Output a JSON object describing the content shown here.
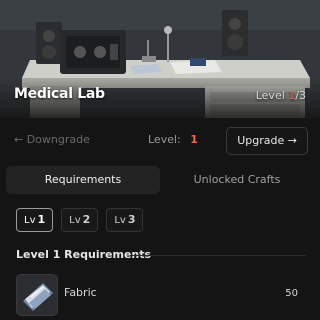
{
  "facility": {
    "name": "Medical Lab",
    "level_label": "Level",
    "level_current": "1",
    "level_total": "/3"
  },
  "level_nav": {
    "downgrade_label": "← Downgrade",
    "level_label": "Level:",
    "level_value": "1",
    "upgrade_label": "Upgrade →"
  },
  "tabs": [
    {
      "label": "Requirements",
      "active": true
    },
    {
      "label": "Unlocked Crafts",
      "active": false
    }
  ],
  "level_chips": [
    {
      "prefix": "Lv",
      "num": "1",
      "active": true
    },
    {
      "prefix": "Lv",
      "num": "2",
      "active": false
    },
    {
      "prefix": "Lv",
      "num": "3",
      "active": false
    }
  ],
  "requirements": {
    "heading": "Level 1 Requirements",
    "items": [
      {
        "name": "Fabric",
        "quantity": "50",
        "icon": "fabric-icon"
      }
    ]
  },
  "colors": {
    "accent": "#f06a4a",
    "background": "#141414",
    "active_tab": "#232323"
  }
}
